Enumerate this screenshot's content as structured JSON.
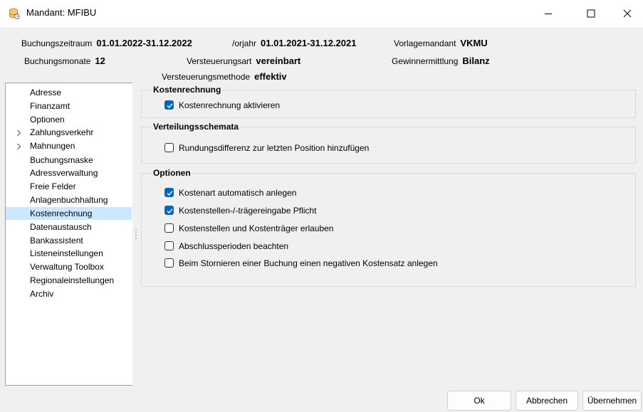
{
  "window": {
    "title": "Mandant: MFIBU"
  },
  "header": {
    "buchungszeitraum": {
      "label": "Buchungszeitraum",
      "value": "01.01.2022-31.12.2022"
    },
    "vorjahr": {
      "label": "/orjahr",
      "value": "01.01.2021-31.12.2021"
    },
    "vorlagemandant": {
      "label": "Vorlagemandant",
      "value": "VKMU"
    },
    "buchungsmonate": {
      "label": "Buchungsmonate",
      "value": "12"
    },
    "versteuerungsart": {
      "label": "Versteuerungsart",
      "value": "vereinbart"
    },
    "gewinnermittlung": {
      "label": "Gewinnermittlung",
      "value": "Bilanz"
    },
    "versteuerungsmethode": {
      "label": "Versteuerungsmethode",
      "value": "effektiv"
    }
  },
  "nav": {
    "items": [
      {
        "label": "Adresse"
      },
      {
        "label": "Finanzamt"
      },
      {
        "label": "Optionen"
      },
      {
        "label": "Zahlungsverkehr",
        "expandable": true
      },
      {
        "label": "Mahnungen",
        "expandable": true
      },
      {
        "label": "Buchungsmaske"
      },
      {
        "label": "Adressverwaltung"
      },
      {
        "label": "Freie Felder"
      },
      {
        "label": "Anlagenbuchhaltung"
      },
      {
        "label": "Kostenrechnung",
        "selected": true
      },
      {
        "label": "Datenaustausch"
      },
      {
        "label": "Bankassistent"
      },
      {
        "label": "Listeneinstellungen"
      },
      {
        "label": "Verwaltung Toolbox"
      },
      {
        "label": "Regionaleinstellungen"
      },
      {
        "label": "Archiv"
      }
    ]
  },
  "groups": {
    "kostenrechnung": {
      "title": "Kostenrechnung",
      "options": [
        {
          "label": "Kostenrechnung aktivieren",
          "checked": true
        }
      ]
    },
    "verteilungsschemata": {
      "title": "Verteilungsschemata",
      "options": [
        {
          "label": "Rundungsdifferenz zur letzten Position hinzufügen",
          "checked": false
        }
      ]
    },
    "optionen": {
      "title": "Optionen",
      "options": [
        {
          "label": "Kostenart automatisch anlegen",
          "checked": true
        },
        {
          "label": "Kostenstellen-/-trägereingabe Pflicht",
          "checked": true
        },
        {
          "label": "Kostenstellen und Kostenträger erlauben",
          "checked": false
        },
        {
          "label": "Abschlussperioden beachten",
          "checked": false
        },
        {
          "label": "Beim Stornieren einer Buchung einen negativen Kostensatz anlegen",
          "checked": false
        }
      ]
    }
  },
  "buttons": {
    "ok": "Ok",
    "cancel": "Abbrechen",
    "apply": "Übernehmen"
  },
  "colors": {
    "accent": "#0067c0",
    "selection": "#cce8ff"
  }
}
